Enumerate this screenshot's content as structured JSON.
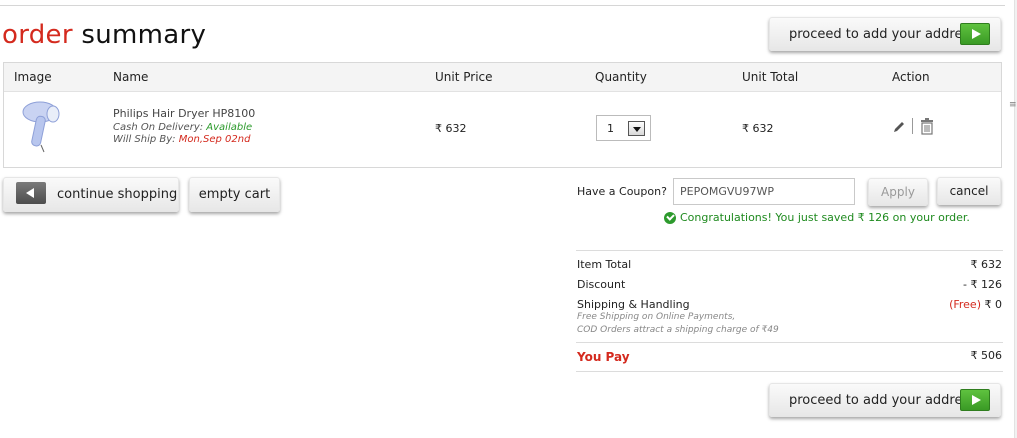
{
  "page": {
    "title_part1": "order",
    "title_part2": "summary"
  },
  "proceed_label": "proceed to add your address",
  "table": {
    "headers": [
      "Image",
      "Name",
      "Unit Price",
      "Quantity",
      "Unit Total",
      "Action"
    ],
    "rows": [
      {
        "name": "Philips Hair Dryer HP8100",
        "cod_label": "Cash On Delivery:",
        "cod_value": "Available",
        "ship_label": "Will Ship By:",
        "ship_value": "Mon,Sep 02nd",
        "unit_price": "₹ 632",
        "quantity": "1",
        "unit_total": "₹ 632"
      }
    ]
  },
  "buttons": {
    "continue": "continue shopping",
    "empty": "empty cart",
    "apply": "Apply",
    "cancel": "cancel"
  },
  "coupon": {
    "label": "Have a Coupon?",
    "value": "PEPOMGVU97WP",
    "message": "Congratulations! You just saved ₹  126 on your order."
  },
  "summary": {
    "item_total_label": "Item Total",
    "item_total_value": "₹ 632",
    "discount_label": "Discount",
    "discount_value": "- ₹ 126",
    "shipping_label": "Shipping & Handling",
    "shipping_free": "(Free)",
    "shipping_value": "₹ 0",
    "note1": "Free Shipping on Online Payments,",
    "note2": "COD Orders attract a shipping charge of ₹49",
    "you_pay_label": "You Pay",
    "you_pay_value": "₹ 506"
  },
  "colors": {
    "accent_red": "#d42a1e",
    "success_green": "#2b9a2b",
    "play_green": "#4caf33"
  }
}
